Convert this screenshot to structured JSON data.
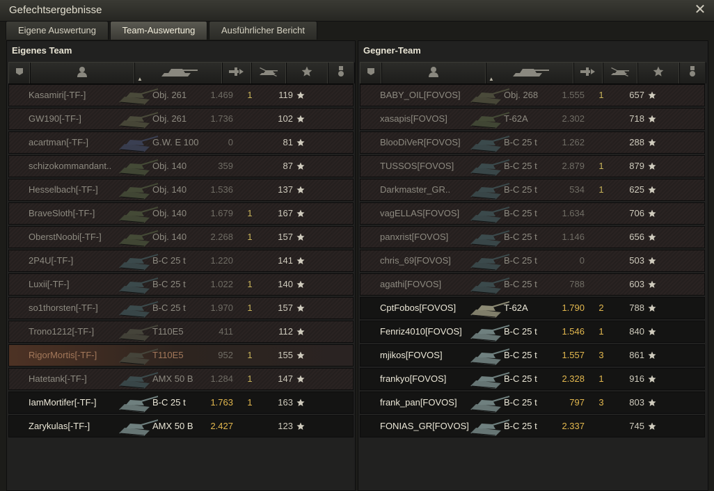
{
  "window": {
    "title": "Gefechtsergebnisse"
  },
  "tabs": [
    {
      "label": "Eigene Auswertung",
      "active": false
    },
    {
      "label": "Team-Auswertung",
      "active": true
    },
    {
      "label": "Ausführlicher Bericht",
      "active": false
    }
  ],
  "own_team": {
    "title": "Eigenes Team",
    "columns": [
      "squad-icon",
      "player-icon",
      "tank-icon",
      "damage-icon",
      "kills-icon",
      "xp-star-icon",
      "medal-icon"
    ],
    "rows": [
      {
        "name": "Kasamiri[-TF-]",
        "vehicle": "Obj. 261",
        "damage": "1.469",
        "kills": "1",
        "xp": "119",
        "state": "destroyed",
        "tank_color": "#4a4a3a"
      },
      {
        "name": "GW190[-TF-]",
        "vehicle": "Obj. 261",
        "damage": "1.736",
        "kills": "",
        "xp": "102",
        "state": "destroyed",
        "tank_color": "#4a4a3a"
      },
      {
        "name": "acartman[-TF-]",
        "vehicle": "G.W. E 100",
        "damage": "0",
        "kills": "",
        "xp": "81",
        "state": "destroyed",
        "tank_color": "#3a3f52"
      },
      {
        "name": "schizokommandant..",
        "vehicle": "Obj. 140",
        "damage": "359",
        "kills": "",
        "xp": "87",
        "state": "destroyed",
        "tank_color": "#444a36"
      },
      {
        "name": "Hesselbach[-TF-]",
        "vehicle": "Obj. 140",
        "damage": "1.536",
        "kills": "",
        "xp": "137",
        "state": "destroyed",
        "tank_color": "#444a36"
      },
      {
        "name": "BraveSloth[-TF-]",
        "vehicle": "Obj. 140",
        "damage": "1.679",
        "kills": "1",
        "xp": "167",
        "state": "destroyed",
        "tank_color": "#444a36"
      },
      {
        "name": "OberstNoobi[-TF-]",
        "vehicle": "Obj. 140",
        "damage": "2.268",
        "kills": "1",
        "xp": "157",
        "state": "destroyed",
        "tank_color": "#444a36"
      },
      {
        "name": "2P4U[-TF-]",
        "vehicle": "B-C 25 t",
        "damage": "1.220",
        "kills": "",
        "xp": "141",
        "state": "destroyed",
        "tank_color": "#3b4a4c"
      },
      {
        "name": "Luxii[-TF-]",
        "vehicle": "B-C 25 t",
        "damage": "1.022",
        "kills": "1",
        "xp": "140",
        "state": "destroyed",
        "tank_color": "#3b4a4c"
      },
      {
        "name": "so1thorsten[-TF-]",
        "vehicle": "B-C 25 t",
        "damage": "1.970",
        "kills": "1",
        "xp": "157",
        "state": "destroyed",
        "tank_color": "#3b4a4c"
      },
      {
        "name": "Trono1212[-TF-]",
        "vehicle": "T110E5",
        "damage": "411",
        "kills": "",
        "xp": "112",
        "state": "destroyed",
        "tank_color": "#45443a"
      },
      {
        "name": "RigorMortis[-TF-]",
        "vehicle": "T110E5",
        "damage": "952",
        "kills": "1",
        "xp": "155",
        "state": "self",
        "tank_color": "#45443a"
      },
      {
        "name": "Hatetank[-TF-]",
        "vehicle": "AMX 50 B",
        "damage": "1.284",
        "kills": "1",
        "xp": "147",
        "state": "destroyed",
        "tank_color": "#3b4a4c"
      },
      {
        "name": "IamMortifer[-TF-]",
        "vehicle": "B-C 25 t",
        "damage": "1.763",
        "kills": "1",
        "xp": "163",
        "state": "alive",
        "tank_color": "#6f807f"
      },
      {
        "name": "Zarykulas[-TF-]",
        "vehicle": "AMX 50 B",
        "damage": "2.427",
        "kills": "",
        "xp": "123",
        "state": "alive",
        "tank_color": "#6f807f"
      }
    ]
  },
  "enemy_team": {
    "title": "Gegner-Team",
    "columns": [
      "squad-icon",
      "player-icon",
      "tank-icon",
      "damage-icon",
      "kills-icon",
      "xp-star-icon",
      "medal-icon"
    ],
    "rows": [
      {
        "name": "BABY_OIL[FOVOS]",
        "vehicle": "Obj. 268",
        "damage": "1.555",
        "kills": "1",
        "xp": "657",
        "state": "destroyed",
        "tank_color": "#4a4a3a"
      },
      {
        "name": "xasapis[FOVOS]",
        "vehicle": "T-62A",
        "damage": "2.302",
        "kills": "",
        "xp": "718",
        "state": "destroyed",
        "tank_color": "#444a36"
      },
      {
        "name": "BlooDiVeR[FOVOS]",
        "vehicle": "B-C 25 t",
        "damage": "1.262",
        "kills": "",
        "xp": "288",
        "state": "destroyed",
        "tank_color": "#3b4a4c"
      },
      {
        "name": "TUSSOS[FOVOS]",
        "vehicle": "B-C 25 t",
        "damage": "2.879",
        "kills": "1",
        "xp": "879",
        "state": "destroyed",
        "tank_color": "#3b4a4c"
      },
      {
        "name": "Darkmaster_GR..",
        "vehicle": "B-C 25 t",
        "damage": "534",
        "kills": "1",
        "xp": "625",
        "state": "destroyed",
        "tank_color": "#3b4a4c"
      },
      {
        "name": "vagELLAS[FOVOS]",
        "vehicle": "B-C 25 t",
        "damage": "1.634",
        "kills": "",
        "xp": "706",
        "state": "destroyed",
        "tank_color": "#3b4a4c"
      },
      {
        "name": "panxrist[FOVOS]",
        "vehicle": "B-C 25 t",
        "damage": "1.146",
        "kills": "",
        "xp": "656",
        "state": "destroyed",
        "tank_color": "#3b4a4c"
      },
      {
        "name": "chris_69[FOVOS]",
        "vehicle": "B-C 25 t",
        "damage": "0",
        "kills": "",
        "xp": "503",
        "state": "destroyed",
        "tank_color": "#3b4a4c"
      },
      {
        "name": "agathi[FOVOS]",
        "vehicle": "B-C 25 t",
        "damage": "788",
        "kills": "",
        "xp": "603",
        "state": "destroyed",
        "tank_color": "#3b4a4c"
      },
      {
        "name": "CptFobos[FOVOS]",
        "vehicle": "T-62A",
        "damage": "1.790",
        "kills": "2",
        "xp": "788",
        "state": "alive",
        "tank_color": "#8c8a74"
      },
      {
        "name": "Fenriz4010[FOVOS]",
        "vehicle": "B-C 25 t",
        "damage": "1.546",
        "kills": "1",
        "xp": "840",
        "state": "alive",
        "tank_color": "#6f807f"
      },
      {
        "name": "mjikos[FOVOS]",
        "vehicle": "B-C 25 t",
        "damage": "1.557",
        "kills": "3",
        "xp": "861",
        "state": "alive",
        "tank_color": "#6f807f"
      },
      {
        "name": "frankyo[FOVOS]",
        "vehicle": "B-C 25 t",
        "damage": "2.328",
        "kills": "1",
        "xp": "916",
        "state": "alive",
        "tank_color": "#6f807f"
      },
      {
        "name": "frank_pan[FOVOS]",
        "vehicle": "B-C 25 t",
        "damage": "797",
        "kills": "3",
        "xp": "803",
        "state": "alive",
        "tank_color": "#6f807f"
      },
      {
        "name": "FONIAS_GR[FOVOS]",
        "vehicle": "B-C 25 t",
        "damage": "2.337",
        "kills": "",
        "xp": "745",
        "state": "alive",
        "tank_color": "#6f807f"
      }
    ]
  }
}
